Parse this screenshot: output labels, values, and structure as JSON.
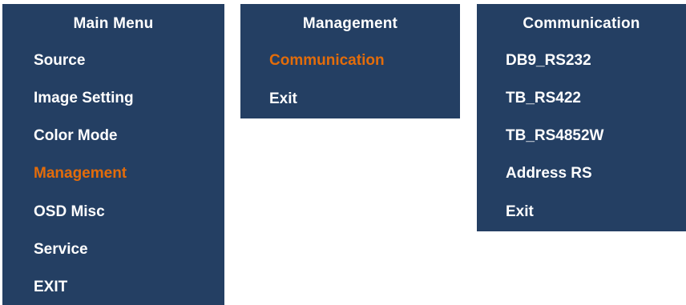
{
  "main_menu": {
    "title": "Main Menu",
    "items": [
      {
        "label": "Source"
      },
      {
        "label": "Image Setting"
      },
      {
        "label": "Color Mode"
      },
      {
        "label": "Management"
      },
      {
        "label": "OSD Misc"
      },
      {
        "label": "Service"
      },
      {
        "label": "EXIT"
      }
    ],
    "selected_item": "Management"
  },
  "management_menu": {
    "title": "Management",
    "items": [
      {
        "label": "Communication"
      },
      {
        "label": "Exit"
      }
    ],
    "selected_item": "Communication"
  },
  "communication_menu": {
    "title": "Communication",
    "items": [
      {
        "label": "DB9_RS232"
      },
      {
        "label": "TB_RS422"
      },
      {
        "label": "TB_RS4852W"
      },
      {
        "label": "Address RS"
      },
      {
        "label": "Exit"
      }
    ]
  },
  "colors": {
    "panel_background": "#243f63",
    "text": "#ffffff",
    "highlight": "#e36c0a"
  }
}
